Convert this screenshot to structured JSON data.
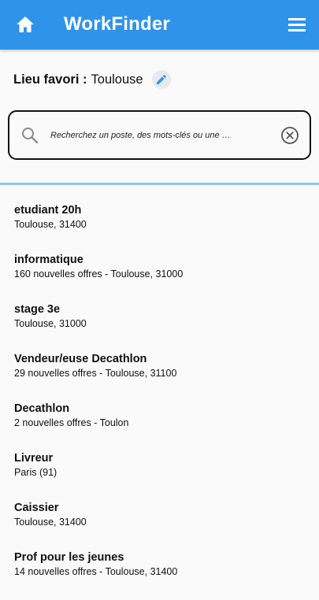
{
  "theme": {
    "appbar_color": "#2f93ea",
    "divider_color": "#8cc5f4",
    "edit_icon_color": "#2f93ea"
  },
  "header": {
    "title": "WorkFinder",
    "home_icon": "home-icon",
    "menu_icon": "hamburger-menu-icon"
  },
  "favorite": {
    "label": "Lieu favori :",
    "value": "Toulouse",
    "edit_icon": "pencil-icon"
  },
  "search": {
    "placeholder": "Recherchez un poste, des mots-clés ou une …",
    "value": "",
    "search_icon": "search-icon",
    "clear_icon": "clear-circle-icon"
  },
  "recent_searches": [
    {
      "title": "etudiant 20h",
      "subtitle": "Toulouse, 31400"
    },
    {
      "title": "informatique",
      "subtitle": "160 nouvelles offres - Toulouse, 31000"
    },
    {
      "title": "stage 3e",
      "subtitle": "Toulouse, 31000"
    },
    {
      "title": "Vendeur/euse Decathlon",
      "subtitle": "29 nouvelles offres - Toulouse, 31100"
    },
    {
      "title": "Decathlon",
      "subtitle": "2 nouvelles offres - Toulon"
    },
    {
      "title": "Livreur",
      "subtitle": "Paris (91)"
    },
    {
      "title": "Caissier",
      "subtitle": "Toulouse, 31400"
    },
    {
      "title": "Prof pour les jeunes",
      "subtitle": "14 nouvelles offres - Toulouse, 31400"
    }
  ]
}
